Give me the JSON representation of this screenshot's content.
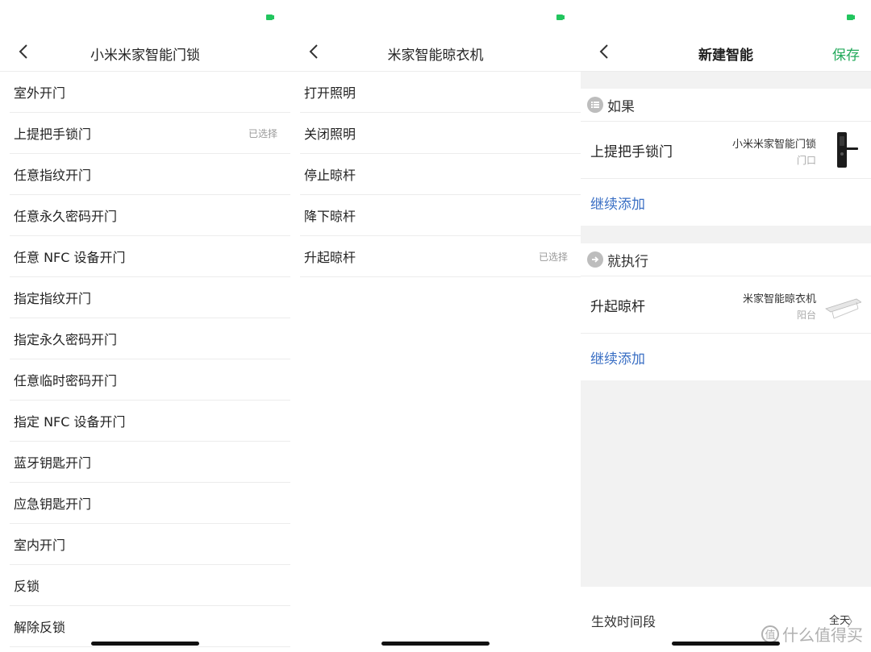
{
  "colors": {
    "accent_green": "#22a95a",
    "link_blue": "#3a6fc4",
    "battery_green": "#22c55e"
  },
  "panel1": {
    "title": "小米米家智能门锁",
    "items": [
      {
        "label": "室外开门",
        "badge": ""
      },
      {
        "label": "上提把手锁门",
        "badge": "已选择"
      },
      {
        "label": "任意指纹开门",
        "badge": ""
      },
      {
        "label": "任意永久密码开门",
        "badge": ""
      },
      {
        "label": "任意 NFC 设备开门",
        "badge": ""
      },
      {
        "label": "指定指纹开门",
        "badge": ""
      },
      {
        "label": "指定永久密码开门",
        "badge": ""
      },
      {
        "label": "任意临时密码开门",
        "badge": ""
      },
      {
        "label": "指定 NFC 设备开门",
        "badge": ""
      },
      {
        "label": "蓝牙钥匙开门",
        "badge": ""
      },
      {
        "label": "应急钥匙开门",
        "badge": ""
      },
      {
        "label": "室内开门",
        "badge": ""
      },
      {
        "label": "反锁",
        "badge": ""
      },
      {
        "label": "解除反锁",
        "badge": ""
      }
    ]
  },
  "panel2": {
    "title": "米家智能晾衣机",
    "items": [
      {
        "label": "打开照明",
        "badge": ""
      },
      {
        "label": "关闭照明",
        "badge": ""
      },
      {
        "label": "停止晾杆",
        "badge": ""
      },
      {
        "label": "降下晾杆",
        "badge": ""
      },
      {
        "label": "升起晾杆",
        "badge": "已选择"
      }
    ]
  },
  "panel3": {
    "title": "新建智能",
    "save_label": "保存",
    "if_section": {
      "title": "如果",
      "action": "上提把手锁门",
      "device": "小米米家智能门锁",
      "room": "门口",
      "add_label": "继续添加"
    },
    "then_section": {
      "title": "就执行",
      "action": "升起晾杆",
      "device": "米家智能晾衣机",
      "room": "阳台",
      "add_label": "继续添加"
    },
    "footer": {
      "label": "生效时间段",
      "value": "全天"
    }
  },
  "watermark": {
    "glyph": "值",
    "text": "什么值得买"
  }
}
